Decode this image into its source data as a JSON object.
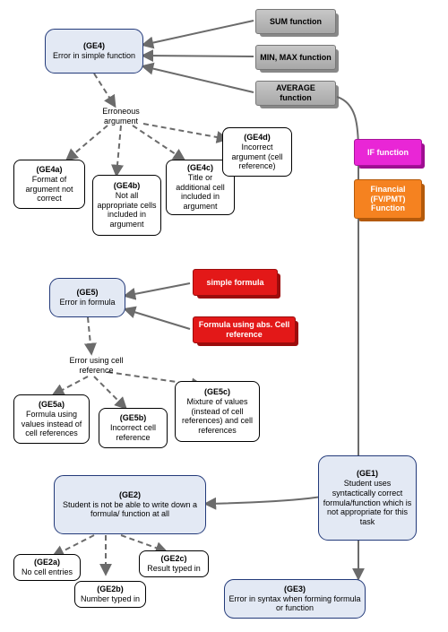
{
  "banners": {
    "sum": "SUM function",
    "minmax": "MIN, MAX function",
    "average": "AVERAGE function",
    "if": "IF function",
    "financial": "Financial (FV/PMT) Function",
    "simple_formula": "simple formula",
    "abs_formula": "Formula using abs. Cell reference"
  },
  "nodes": {
    "ge4": {
      "title": "(GE4)",
      "text": "Error in simple function"
    },
    "ge4_label": "Erroneous argument",
    "ge4a": {
      "title": "(GE4a)",
      "text": "Format of argument not correct"
    },
    "ge4b": {
      "title": "(GE4b)",
      "text": "Not  all appropriate cells included in argument"
    },
    "ge4c": {
      "title": "(GE4c)",
      "text": "Title or additional cell included in argument"
    },
    "ge4d": {
      "title": "(GE4d)",
      "text": "Incorrect argument (cell reference)"
    },
    "ge5": {
      "title": "(GE5)",
      "text": "Error in formula"
    },
    "ge5_label": "Error using cell reference",
    "ge5a": {
      "title": "(GE5a)",
      "text": "Formula using values instead of cell references"
    },
    "ge5b": {
      "title": "(GE5b)",
      "text": "Incorrect cell reference"
    },
    "ge5c": {
      "title": "(GE5c)",
      "text": "Mixture of values (instead of cell references) and cell references"
    },
    "ge2": {
      "title": "(GE2)",
      "text": "Student is not be able to write down a formula/ function at all"
    },
    "ge2a": {
      "title": "(GE2a)",
      "text": "No cell entries"
    },
    "ge2b": {
      "title": "(GE2b)",
      "text": "Number typed in"
    },
    "ge2c": {
      "title": "(GE2c)",
      "text": "Result typed in"
    },
    "ge1": {
      "title": "(GE1)",
      "text": "Student uses syntactically correct formula/function which is not appropriate for this task"
    },
    "ge3": {
      "title": "(GE3)",
      "text": "Error in syntax when forming formula or function"
    }
  }
}
